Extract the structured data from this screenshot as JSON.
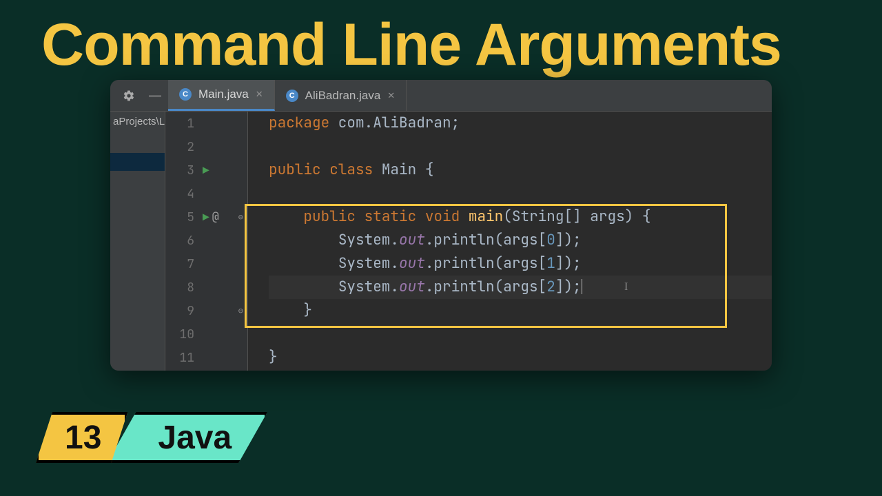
{
  "title": "Command Line Arguments",
  "sidebar_text": "aProjects\\Le",
  "tabs": [
    {
      "label": "Main.java",
      "active": true
    },
    {
      "label": "AliBadran.java",
      "active": false
    }
  ],
  "gutter": [
    {
      "n": "1"
    },
    {
      "n": "2"
    },
    {
      "n": "3",
      "run": true
    },
    {
      "n": "4"
    },
    {
      "n": "5",
      "run": true,
      "at": true,
      "fold": "⊖"
    },
    {
      "n": "6"
    },
    {
      "n": "7"
    },
    {
      "n": "8"
    },
    {
      "n": "9",
      "fold": "⊖"
    },
    {
      "n": "10"
    },
    {
      "n": "11"
    }
  ],
  "code": {
    "l1_kw": "package",
    "l1_rest": " com.AliBadran;",
    "l3_kw1": "public",
    "l3_kw2": "class",
    "l3_name": " Main ",
    "l3_brace": "{",
    "l5_kw1": "public",
    "l5_kw2": "static",
    "l5_kw3": "void",
    "l5_fn": "main",
    "l5_sig": "(String[] args) ",
    "l5_brace": "{",
    "l6_obj": "System.",
    "l6_out": "out",
    "l6_call": ".println(args[",
    "l6_idx": "0",
    "l6_end": "]);",
    "l7_obj": "System.",
    "l7_out": "out",
    "l7_call": ".println(args[",
    "l7_idx": "1",
    "l7_end": "]);",
    "l8_obj": "System.",
    "l8_out": "out",
    "l8_call": ".println(args[",
    "l8_idx": "2",
    "l8_end": "]);",
    "l9_brace": "}",
    "l11_brace": "}"
  },
  "episode_number": "13",
  "language_label": "Java"
}
